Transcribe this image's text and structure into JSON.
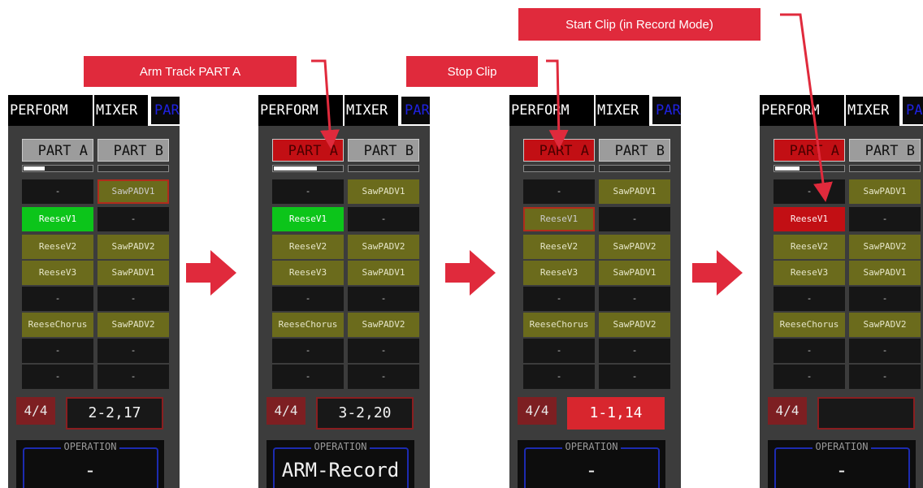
{
  "callouts": [
    {
      "text": "Arm Track PART A"
    },
    {
      "text": "Stop Clip"
    },
    {
      "text": "Start Clip (in Record Mode)"
    }
  ],
  "tabs": {
    "perform": "PERFORM",
    "mixer": "MIXER",
    "part": "PAR"
  },
  "colors": {
    "callout": "#e02a3c",
    "armed": "#c20f14",
    "playing": "#0cc51a",
    "filled": "#6b6b1c",
    "recording": "#c20f14"
  },
  "panels": [
    {
      "part_a": {
        "label": "PART A",
        "armed": false,
        "meter_level": 0.3
      },
      "part_b": {
        "label": "PART B",
        "meter_level": 0
      },
      "clips_a": [
        {
          "label": "-",
          "state": "empty"
        },
        {
          "label": "ReeseV1",
          "state": "playing"
        },
        {
          "label": "ReeseV2",
          "state": "filled"
        },
        {
          "label": "ReeseV3",
          "state": "filled"
        },
        {
          "label": "-",
          "state": "empty"
        },
        {
          "label": "ReeseChorus",
          "state": "filled"
        },
        {
          "label": "-",
          "state": "empty"
        },
        {
          "label": "-",
          "state": "empty"
        }
      ],
      "clips_b": [
        {
          "label": "SawPADV1",
          "state": "stopping"
        },
        {
          "label": "-",
          "state": "empty"
        },
        {
          "label": "SawPADV2",
          "state": "filled"
        },
        {
          "label": "SawPADV1",
          "state": "filled"
        },
        {
          "label": "-",
          "state": "empty"
        },
        {
          "label": "SawPADV2",
          "state": "filled"
        },
        {
          "label": "-",
          "state": "empty"
        },
        {
          "label": "-",
          "state": "empty"
        }
      ],
      "time_signature": "4/4",
      "position": "2-2,17",
      "position_active": false,
      "operation_label": "OPERATION",
      "operation": "-"
    },
    {
      "part_a": {
        "label": "PART A",
        "armed": true,
        "meter_level": 0.62
      },
      "part_b": {
        "label": "PART B",
        "meter_level": 0
      },
      "clips_a": [
        {
          "label": "-",
          "state": "empty"
        },
        {
          "label": "ReeseV1",
          "state": "playing"
        },
        {
          "label": "ReeseV2",
          "state": "filled"
        },
        {
          "label": "ReeseV3",
          "state": "filled"
        },
        {
          "label": "-",
          "state": "empty"
        },
        {
          "label": "ReeseChorus",
          "state": "filled"
        },
        {
          "label": "-",
          "state": "empty"
        },
        {
          "label": "-",
          "state": "empty"
        }
      ],
      "clips_b": [
        {
          "label": "SawPADV1",
          "state": "filled"
        },
        {
          "label": "-",
          "state": "empty"
        },
        {
          "label": "SawPADV2",
          "state": "filled"
        },
        {
          "label": "SawPADV1",
          "state": "filled"
        },
        {
          "label": "-",
          "state": "empty"
        },
        {
          "label": "SawPADV2",
          "state": "filled"
        },
        {
          "label": "-",
          "state": "empty"
        },
        {
          "label": "-",
          "state": "empty"
        }
      ],
      "time_signature": "4/4",
      "position": "3-2,20",
      "position_active": false,
      "operation_label": "OPERATION",
      "operation": "ARM-Record"
    },
    {
      "part_a": {
        "label": "PART A",
        "armed": true,
        "meter_level": 0
      },
      "part_b": {
        "label": "PART B",
        "meter_level": 0
      },
      "clips_a": [
        {
          "label": "-",
          "state": "empty"
        },
        {
          "label": "ReeseV1",
          "state": "stopping"
        },
        {
          "label": "ReeseV2",
          "state": "filled"
        },
        {
          "label": "ReeseV3",
          "state": "filled"
        },
        {
          "label": "-",
          "state": "empty"
        },
        {
          "label": "ReeseChorus",
          "state": "filled"
        },
        {
          "label": "-",
          "state": "empty"
        },
        {
          "label": "-",
          "state": "empty"
        }
      ],
      "clips_b": [
        {
          "label": "SawPADV1",
          "state": "filled"
        },
        {
          "label": "-",
          "state": "empty"
        },
        {
          "label": "SawPADV2",
          "state": "filled"
        },
        {
          "label": "SawPADV1",
          "state": "filled"
        },
        {
          "label": "-",
          "state": "empty"
        },
        {
          "label": "SawPADV2",
          "state": "filled"
        },
        {
          "label": "-",
          "state": "empty"
        },
        {
          "label": "-",
          "state": "empty"
        }
      ],
      "time_signature": "4/4",
      "position": "1-1,14",
      "position_active": true,
      "operation_label": "OPERATION",
      "operation": "-"
    },
    {
      "part_a": {
        "label": "PART A",
        "armed": true,
        "meter_level": 0.35
      },
      "part_b": {
        "label": "PART B",
        "meter_level": 0
      },
      "clips_a": [
        {
          "label": "-",
          "state": "empty"
        },
        {
          "label": "ReeseV1",
          "state": "recording"
        },
        {
          "label": "ReeseV2",
          "state": "filled"
        },
        {
          "label": "ReeseV3",
          "state": "filled"
        },
        {
          "label": "-",
          "state": "empty"
        },
        {
          "label": "ReeseChorus",
          "state": "filled"
        },
        {
          "label": "-",
          "state": "empty"
        },
        {
          "label": "-",
          "state": "empty"
        }
      ],
      "clips_b": [
        {
          "label": "SawPADV1",
          "state": "filled"
        },
        {
          "label": "-",
          "state": "empty"
        },
        {
          "label": "SawPADV2",
          "state": "filled"
        },
        {
          "label": "SawPADV1",
          "state": "filled"
        },
        {
          "label": "-",
          "state": "empty"
        },
        {
          "label": "SawPADV2",
          "state": "filled"
        },
        {
          "label": "-",
          "state": "empty"
        },
        {
          "label": "-",
          "state": "empty"
        }
      ],
      "time_signature": "4/4",
      "position": "",
      "position_active": false,
      "operation_label": "OPERATION",
      "operation": "-"
    }
  ]
}
